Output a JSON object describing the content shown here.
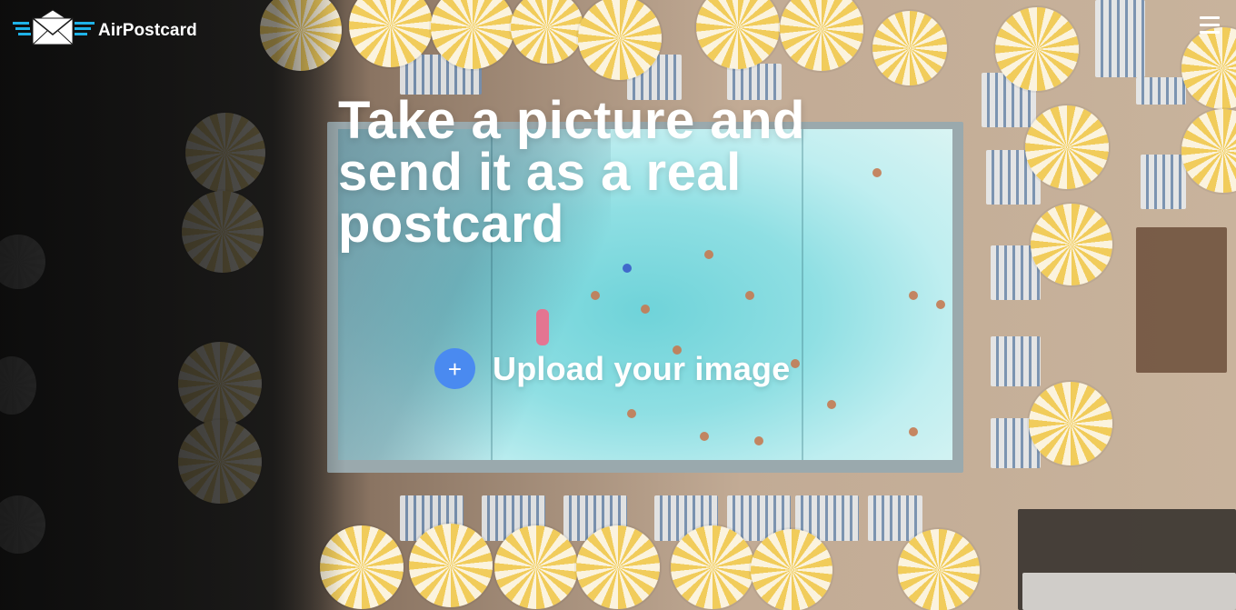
{
  "brand": {
    "name": "AirPostcard",
    "logo_icon": "airmail-envelope-icon",
    "accent_color": "#1fb2e8"
  },
  "header": {
    "menu_icon": "hamburger-menu-icon"
  },
  "hero": {
    "headline": "Take a picture and send it as a real postcard",
    "background": "aerial photo of a pool with yellow-striped umbrellas"
  },
  "upload": {
    "icon": "plus-icon",
    "icon_glyph": "+",
    "label": "Upload your image",
    "button_color": "#4a8af0"
  }
}
